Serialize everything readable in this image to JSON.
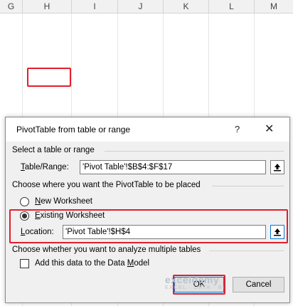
{
  "columns": [
    "G",
    "H",
    "I",
    "J",
    "K",
    "L",
    "M"
  ],
  "dialog": {
    "title": "PivotTable from table or range",
    "help_glyph": "?",
    "close_glyph": "✕",
    "section1": "Select a table or range",
    "table_range_label_pre": "",
    "table_range_label_u": "T",
    "table_range_label_post": "able/Range:",
    "table_range_value": "'Pivot Table'!$B$4:$F$17",
    "section2": "Choose where you want the PivotTable to be placed",
    "new_ws_u": "N",
    "new_ws_post": "ew Worksheet",
    "existing_ws_u": "E",
    "existing_ws_post": "xisting Worksheet",
    "location_label_u": "L",
    "location_label_post": "ocation:",
    "location_value": "'Pivot Table'!$H$4",
    "section3": "Choose whether you want to analyze multiple tables",
    "data_model_pre": "Add this data to the Data ",
    "data_model_u": "M",
    "data_model_post": "odel",
    "ok_label": "OK",
    "cancel_label": "Cancel",
    "selected_placement": "Existing Worksheet",
    "data_model_checked": false
  },
  "watermark": {
    "main": "exceldemy",
    "sub": "EXCEL · DATA · BI"
  },
  "colors": {
    "highlight_red": "#e01f2d",
    "dialog_bg": "#f0f0f0",
    "ok_border": "#0078d7"
  }
}
